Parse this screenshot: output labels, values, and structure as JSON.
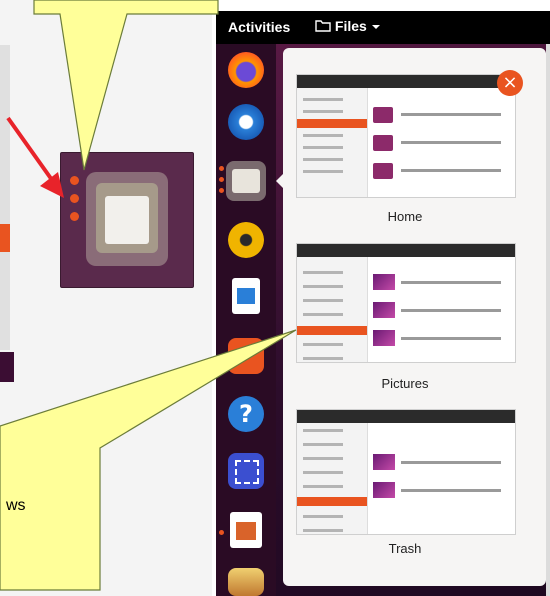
{
  "topbar": {
    "activities_label": "Activities",
    "files_label": "Files"
  },
  "window_previews": [
    {
      "title": "Home"
    },
    {
      "title": "Pictures"
    },
    {
      "title": "Trash"
    }
  ],
  "bottom_callout": {
    "text_fragment": "ws"
  },
  "close_button": {
    "label": "×"
  },
  "colors": {
    "accent": "#e95420",
    "callout_fill": "#ffff99",
    "callout_stroke": "#6b7c3a",
    "topbar": "#000000",
    "dock": "#2a0b24",
    "arrow": "#e8232a"
  },
  "dock_icons": [
    "firefox-icon",
    "thunderbird-icon",
    "files-icon",
    "rhythmbox-icon",
    "writer-icon",
    "software-icon",
    "help-icon",
    "screenshot-icon",
    "impress-icon",
    "shotwell-icon"
  ]
}
